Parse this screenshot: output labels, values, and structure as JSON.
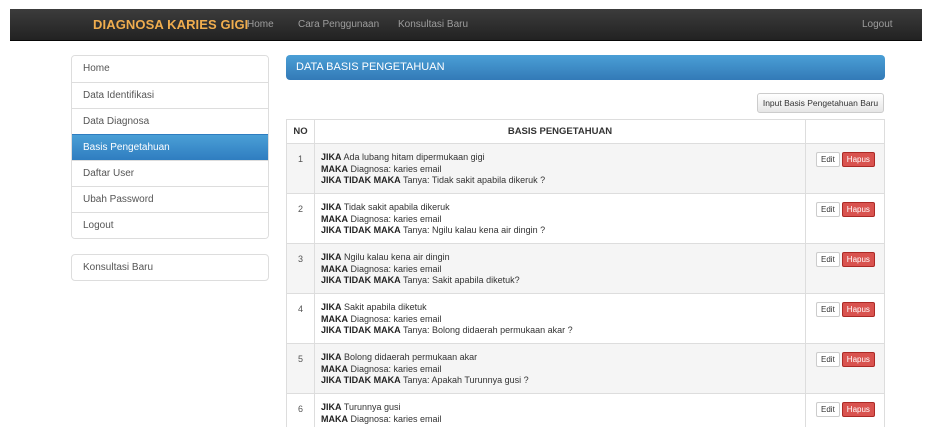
{
  "navbar": {
    "brand": "DIAGNOSA KARIES GIGI",
    "links": [
      "Home",
      "Cara Penggunaan",
      "Konsultasi Baru"
    ],
    "logout": "Logout"
  },
  "sidebar": {
    "items": [
      "Home",
      "Data Identifikasi",
      "Data Diagnosa",
      "Basis Pengetahuan",
      "Daftar User",
      "Ubah Password",
      "Logout"
    ],
    "active": "Basis Pengetahuan",
    "secondary": "Konsultasi Baru"
  },
  "panel": {
    "title": "DATA BASIS PENGETAHUAN",
    "new_button": "Input Basis Pengetahuan Baru"
  },
  "table": {
    "headers": [
      "NO",
      "BASIS PENGETAHUAN",
      ""
    ],
    "kw_if": "JIKA",
    "kw_then": "MAKA",
    "kw_else": "JIKA TIDAK MAKA",
    "edit_label": "Edit",
    "delete_label": "Hapus",
    "rows": [
      {
        "no": "1",
        "if": "Ada lubang hitam dipermukaan gigi",
        "then": "Diagnosa: karies email",
        "else": "Tanya: Tidak sakit apabila dikeruk ?"
      },
      {
        "no": "2",
        "if": "Tidak sakit apabila dikeruk",
        "then": "Diagnosa: karies email",
        "else": "Tanya: Ngilu kalau kena air dingin ?"
      },
      {
        "no": "3",
        "if": "Ngilu kalau kena air dingin",
        "then": "Diagnosa: karies email",
        "else": "Tanya: Sakit apabila diketuk?"
      },
      {
        "no": "4",
        "if": "Sakit apabila diketuk",
        "then": "Diagnosa: karies email",
        "else": "Tanya: Bolong didaerah permukaan akar ?"
      },
      {
        "no": "5",
        "if": "Bolong didaerah permukaan akar",
        "then": "Diagnosa: karies email",
        "else": "Tanya: Apakah Turunnya gusi ?"
      },
      {
        "no": "6",
        "if": "Turunnya gusi",
        "then": "Diagnosa: karies email",
        "else": ""
      }
    ]
  },
  "colors": {
    "brand": "#f0ad4e",
    "primary": "#337ab7",
    "danger": "#d9534f"
  }
}
